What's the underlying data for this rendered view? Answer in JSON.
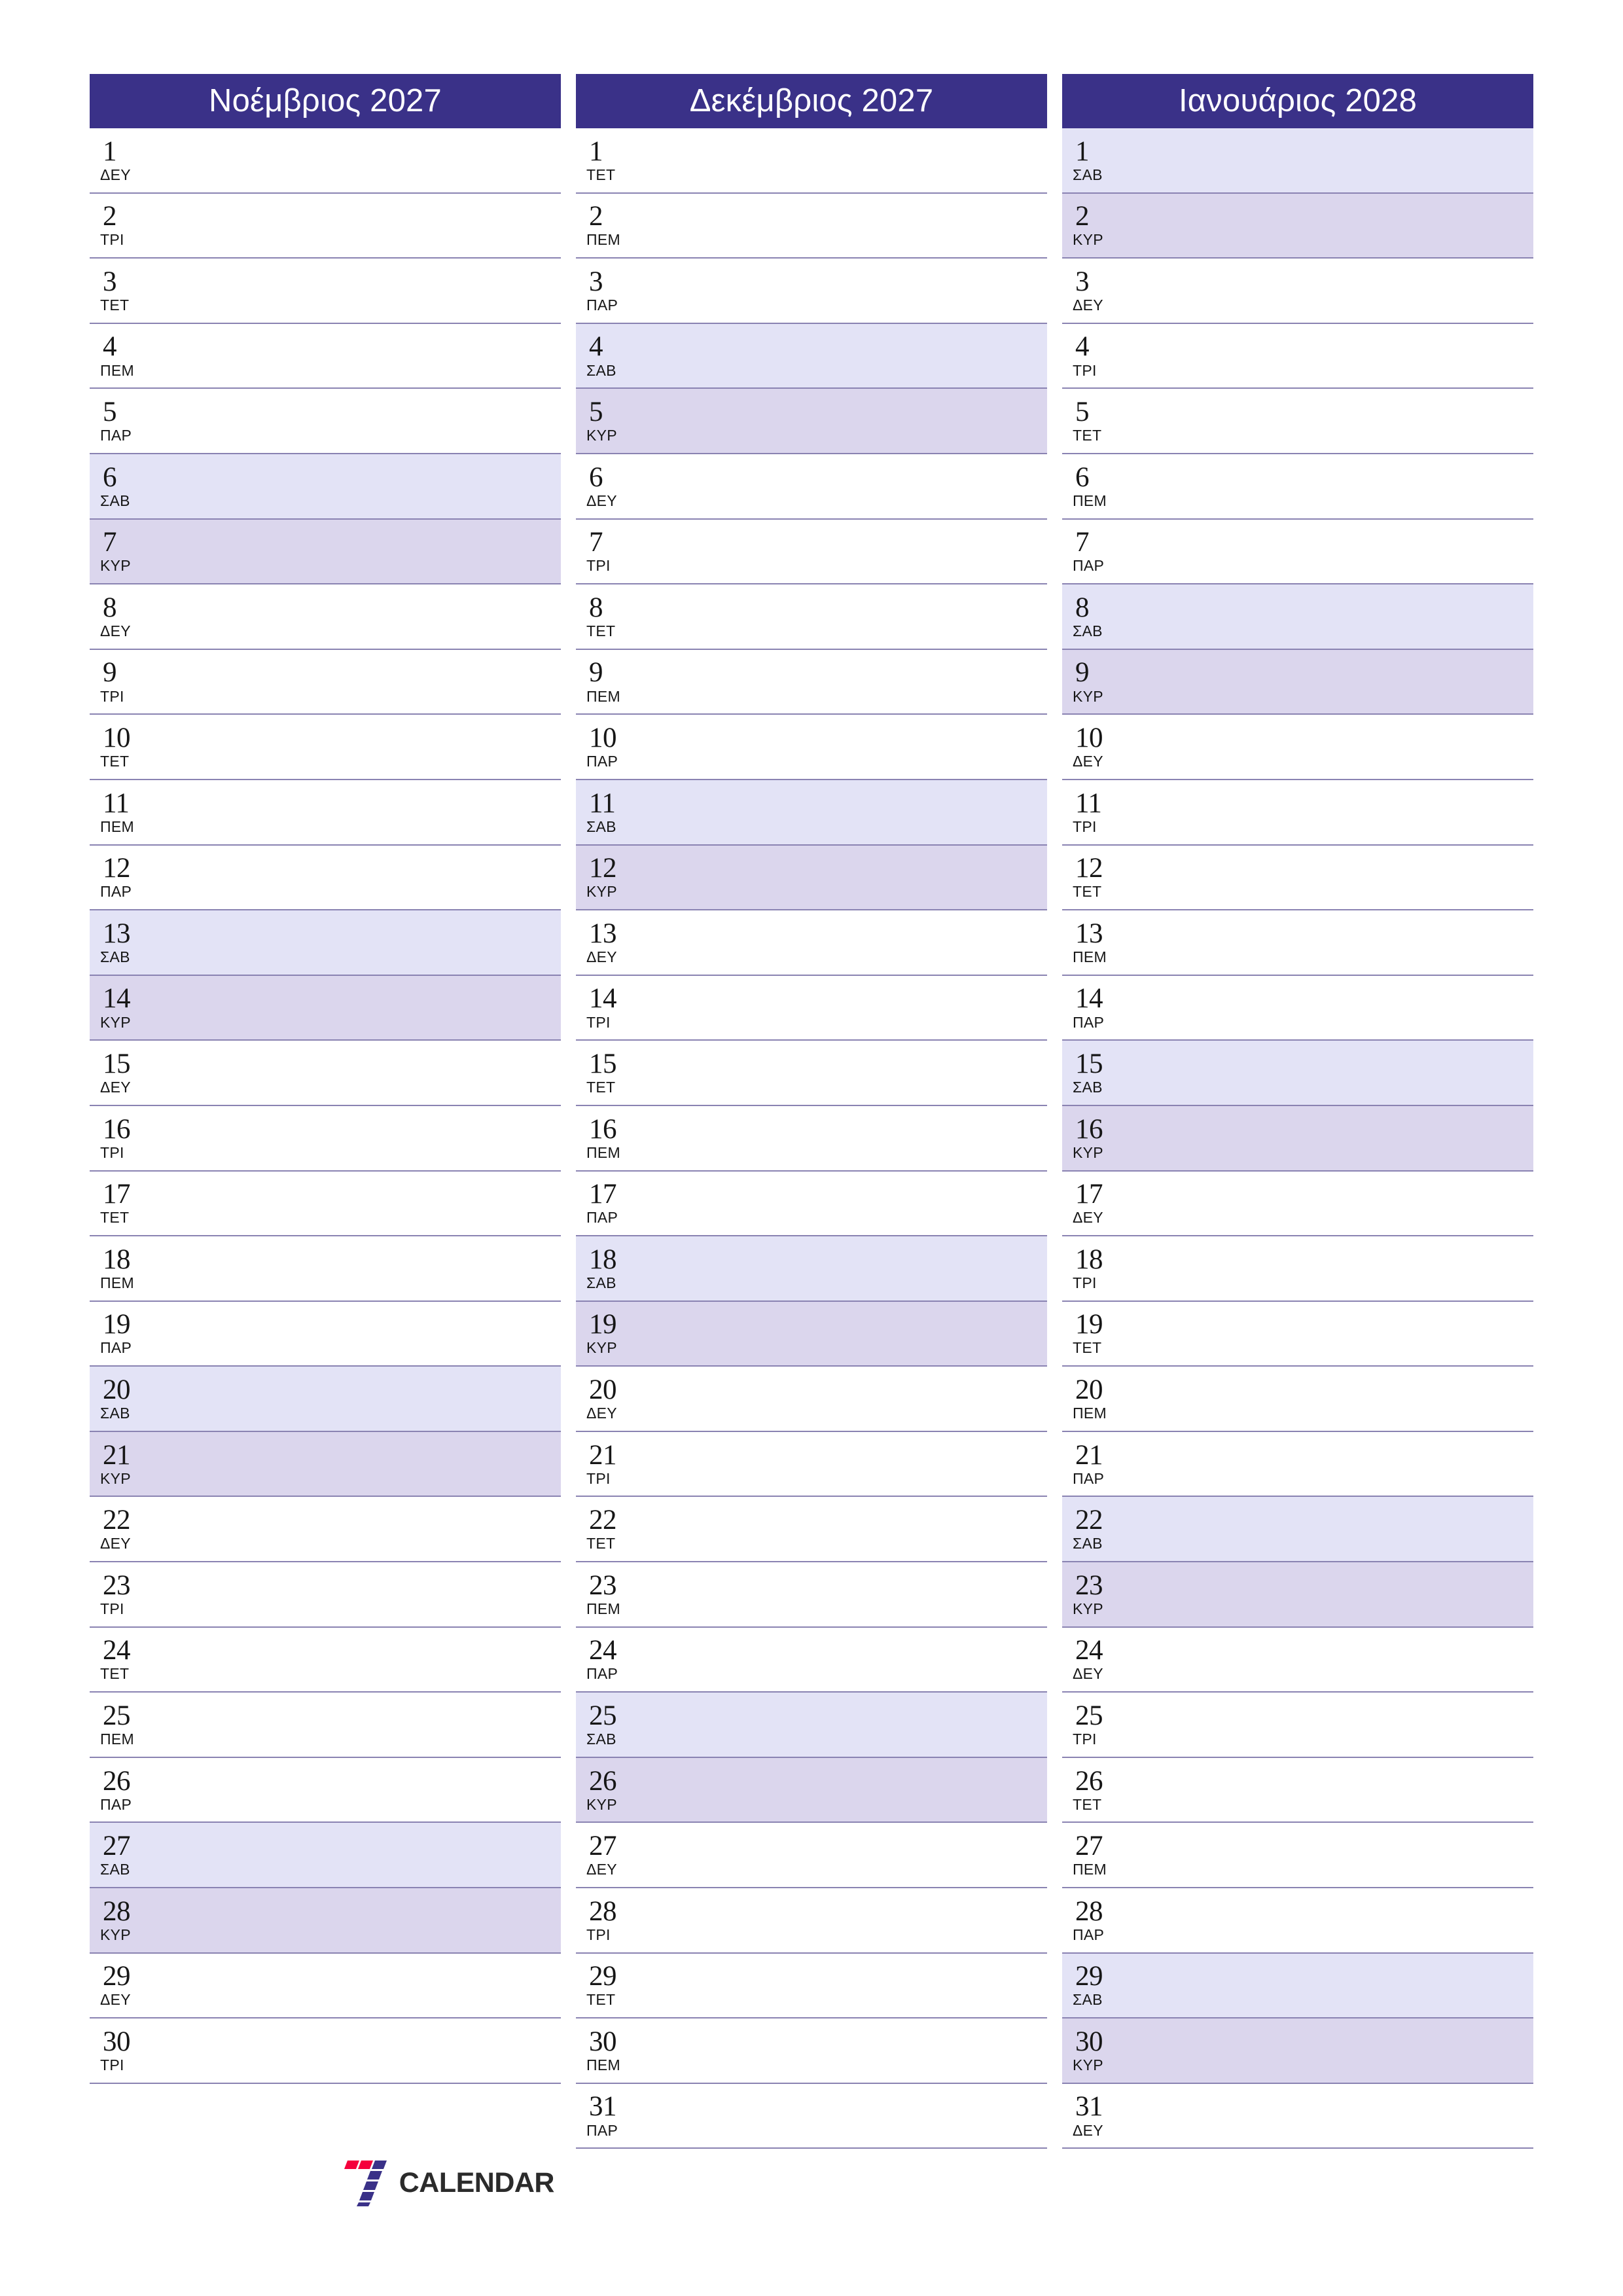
{
  "colors": {
    "header_bg": "#3a3188",
    "header_text": "#ffffff",
    "saturday_bg": "#e3e3f6",
    "sunday_bg": "#dbd6ed",
    "divider": "#8a83b2",
    "logo_red": "#f5003c",
    "logo_purple": "#3a3188",
    "logo_text": "#2b2b2b",
    "page_bg": "#ffffff"
  },
  "logo": {
    "wordmark": "CALENDAR",
    "mark_name": "seven-logo-mark"
  },
  "months": [
    {
      "title": "Νοέμβριος 2027",
      "days": [
        {
          "num": "1",
          "dow": "ΔΕΥ",
          "type": "weekday"
        },
        {
          "num": "2",
          "dow": "ΤΡΙ",
          "type": "weekday"
        },
        {
          "num": "3",
          "dow": "ΤΕΤ",
          "type": "weekday"
        },
        {
          "num": "4",
          "dow": "ΠΕΜ",
          "type": "weekday"
        },
        {
          "num": "5",
          "dow": "ΠΑΡ",
          "type": "weekday"
        },
        {
          "num": "6",
          "dow": "ΣΑΒ",
          "type": "sat"
        },
        {
          "num": "7",
          "dow": "ΚΥΡ",
          "type": "sun"
        },
        {
          "num": "8",
          "dow": "ΔΕΥ",
          "type": "weekday"
        },
        {
          "num": "9",
          "dow": "ΤΡΙ",
          "type": "weekday"
        },
        {
          "num": "10",
          "dow": "ΤΕΤ",
          "type": "weekday"
        },
        {
          "num": "11",
          "dow": "ΠΕΜ",
          "type": "weekday"
        },
        {
          "num": "12",
          "dow": "ΠΑΡ",
          "type": "weekday"
        },
        {
          "num": "13",
          "dow": "ΣΑΒ",
          "type": "sat"
        },
        {
          "num": "14",
          "dow": "ΚΥΡ",
          "type": "sun"
        },
        {
          "num": "15",
          "dow": "ΔΕΥ",
          "type": "weekday"
        },
        {
          "num": "16",
          "dow": "ΤΡΙ",
          "type": "weekday"
        },
        {
          "num": "17",
          "dow": "ΤΕΤ",
          "type": "weekday"
        },
        {
          "num": "18",
          "dow": "ΠΕΜ",
          "type": "weekday"
        },
        {
          "num": "19",
          "dow": "ΠΑΡ",
          "type": "weekday"
        },
        {
          "num": "20",
          "dow": "ΣΑΒ",
          "type": "sat"
        },
        {
          "num": "21",
          "dow": "ΚΥΡ",
          "type": "sun"
        },
        {
          "num": "22",
          "dow": "ΔΕΥ",
          "type": "weekday"
        },
        {
          "num": "23",
          "dow": "ΤΡΙ",
          "type": "weekday"
        },
        {
          "num": "24",
          "dow": "ΤΕΤ",
          "type": "weekday"
        },
        {
          "num": "25",
          "dow": "ΠΕΜ",
          "type": "weekday"
        },
        {
          "num": "26",
          "dow": "ΠΑΡ",
          "type": "weekday"
        },
        {
          "num": "27",
          "dow": "ΣΑΒ",
          "type": "sat"
        },
        {
          "num": "28",
          "dow": "ΚΥΡ",
          "type": "sun"
        },
        {
          "num": "29",
          "dow": "ΔΕΥ",
          "type": "weekday"
        },
        {
          "num": "30",
          "dow": "ΤΡΙ",
          "type": "weekday"
        }
      ]
    },
    {
      "title": "Δεκέμβριος 2027",
      "days": [
        {
          "num": "1",
          "dow": "ΤΕΤ",
          "type": "weekday"
        },
        {
          "num": "2",
          "dow": "ΠΕΜ",
          "type": "weekday"
        },
        {
          "num": "3",
          "dow": "ΠΑΡ",
          "type": "weekday"
        },
        {
          "num": "4",
          "dow": "ΣΑΒ",
          "type": "sat"
        },
        {
          "num": "5",
          "dow": "ΚΥΡ",
          "type": "sun"
        },
        {
          "num": "6",
          "dow": "ΔΕΥ",
          "type": "weekday"
        },
        {
          "num": "7",
          "dow": "ΤΡΙ",
          "type": "weekday"
        },
        {
          "num": "8",
          "dow": "ΤΕΤ",
          "type": "weekday"
        },
        {
          "num": "9",
          "dow": "ΠΕΜ",
          "type": "weekday"
        },
        {
          "num": "10",
          "dow": "ΠΑΡ",
          "type": "weekday"
        },
        {
          "num": "11",
          "dow": "ΣΑΒ",
          "type": "sat"
        },
        {
          "num": "12",
          "dow": "ΚΥΡ",
          "type": "sun"
        },
        {
          "num": "13",
          "dow": "ΔΕΥ",
          "type": "weekday"
        },
        {
          "num": "14",
          "dow": "ΤΡΙ",
          "type": "weekday"
        },
        {
          "num": "15",
          "dow": "ΤΕΤ",
          "type": "weekday"
        },
        {
          "num": "16",
          "dow": "ΠΕΜ",
          "type": "weekday"
        },
        {
          "num": "17",
          "dow": "ΠΑΡ",
          "type": "weekday"
        },
        {
          "num": "18",
          "dow": "ΣΑΒ",
          "type": "sat"
        },
        {
          "num": "19",
          "dow": "ΚΥΡ",
          "type": "sun"
        },
        {
          "num": "20",
          "dow": "ΔΕΥ",
          "type": "weekday"
        },
        {
          "num": "21",
          "dow": "ΤΡΙ",
          "type": "weekday"
        },
        {
          "num": "22",
          "dow": "ΤΕΤ",
          "type": "weekday"
        },
        {
          "num": "23",
          "dow": "ΠΕΜ",
          "type": "weekday"
        },
        {
          "num": "24",
          "dow": "ΠΑΡ",
          "type": "weekday"
        },
        {
          "num": "25",
          "dow": "ΣΑΒ",
          "type": "sat"
        },
        {
          "num": "26",
          "dow": "ΚΥΡ",
          "type": "sun"
        },
        {
          "num": "27",
          "dow": "ΔΕΥ",
          "type": "weekday"
        },
        {
          "num": "28",
          "dow": "ΤΡΙ",
          "type": "weekday"
        },
        {
          "num": "29",
          "dow": "ΤΕΤ",
          "type": "weekday"
        },
        {
          "num": "30",
          "dow": "ΠΕΜ",
          "type": "weekday"
        },
        {
          "num": "31",
          "dow": "ΠΑΡ",
          "type": "weekday"
        }
      ]
    },
    {
      "title": "Ιανουάριος 2028",
      "days": [
        {
          "num": "1",
          "dow": "ΣΑΒ",
          "type": "sat"
        },
        {
          "num": "2",
          "dow": "ΚΥΡ",
          "type": "sun"
        },
        {
          "num": "3",
          "dow": "ΔΕΥ",
          "type": "weekday"
        },
        {
          "num": "4",
          "dow": "ΤΡΙ",
          "type": "weekday"
        },
        {
          "num": "5",
          "dow": "ΤΕΤ",
          "type": "weekday"
        },
        {
          "num": "6",
          "dow": "ΠΕΜ",
          "type": "weekday"
        },
        {
          "num": "7",
          "dow": "ΠΑΡ",
          "type": "weekday"
        },
        {
          "num": "8",
          "dow": "ΣΑΒ",
          "type": "sat"
        },
        {
          "num": "9",
          "dow": "ΚΥΡ",
          "type": "sun"
        },
        {
          "num": "10",
          "dow": "ΔΕΥ",
          "type": "weekday"
        },
        {
          "num": "11",
          "dow": "ΤΡΙ",
          "type": "weekday"
        },
        {
          "num": "12",
          "dow": "ΤΕΤ",
          "type": "weekday"
        },
        {
          "num": "13",
          "dow": "ΠΕΜ",
          "type": "weekday"
        },
        {
          "num": "14",
          "dow": "ΠΑΡ",
          "type": "weekday"
        },
        {
          "num": "15",
          "dow": "ΣΑΒ",
          "type": "sat"
        },
        {
          "num": "16",
          "dow": "ΚΥΡ",
          "type": "sun"
        },
        {
          "num": "17",
          "dow": "ΔΕΥ",
          "type": "weekday"
        },
        {
          "num": "18",
          "dow": "ΤΡΙ",
          "type": "weekday"
        },
        {
          "num": "19",
          "dow": "ΤΕΤ",
          "type": "weekday"
        },
        {
          "num": "20",
          "dow": "ΠΕΜ",
          "type": "weekday"
        },
        {
          "num": "21",
          "dow": "ΠΑΡ",
          "type": "weekday"
        },
        {
          "num": "22",
          "dow": "ΣΑΒ",
          "type": "sat"
        },
        {
          "num": "23",
          "dow": "ΚΥΡ",
          "type": "sun"
        },
        {
          "num": "24",
          "dow": "ΔΕΥ",
          "type": "weekday"
        },
        {
          "num": "25",
          "dow": "ΤΡΙ",
          "type": "weekday"
        },
        {
          "num": "26",
          "dow": "ΤΕΤ",
          "type": "weekday"
        },
        {
          "num": "27",
          "dow": "ΠΕΜ",
          "type": "weekday"
        },
        {
          "num": "28",
          "dow": "ΠΑΡ",
          "type": "weekday"
        },
        {
          "num": "29",
          "dow": "ΣΑΒ",
          "type": "sat"
        },
        {
          "num": "30",
          "dow": "ΚΥΡ",
          "type": "sun"
        },
        {
          "num": "31",
          "dow": "ΔΕΥ",
          "type": "weekday"
        }
      ]
    }
  ]
}
